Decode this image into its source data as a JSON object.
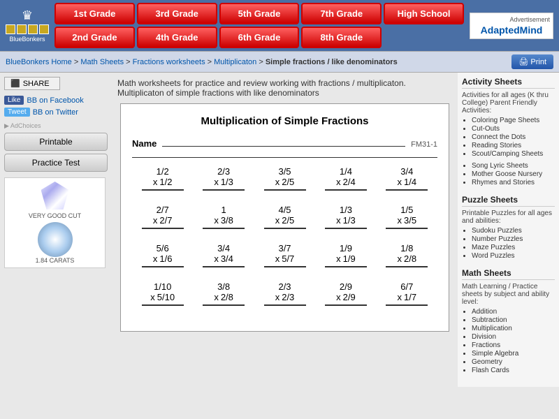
{
  "header": {
    "logo_name": "BlueBonkers",
    "grade_buttons": [
      "1st Grade",
      "3rd Grade",
      "5th Grade",
      "7th Grade",
      "High School",
      "2nd Grade",
      "4th Grade",
      "6th Grade",
      "8th Grade"
    ],
    "adapted_mind_label": "AdaptedMind"
  },
  "breadcrumb": {
    "items": [
      "BlueBonkers Home",
      "Math Sheets",
      "Fractions worksheets",
      "Multiplicaton"
    ],
    "current": "Simple fractions / like denominators"
  },
  "print_btn": "🖨 Print",
  "left_sidebar": {
    "share_label": "SHARE",
    "fb_label": "Like",
    "fb_link": "BB on Facebook",
    "tw_label": "Tweet",
    "tw_link": "BB on Twitter",
    "adchoices": "▶ AdChoices",
    "printable_label": "Printable",
    "practice_label": "Practice Test",
    "ad_text": "VERY GOOD CUT",
    "ad_carats": "1.84 CARATS"
  },
  "intro": {
    "line1": "Math worksheets for practice and review working with fractions / multiplicaton.",
    "line2": "Multiplicaton of simple fractions with like denominators"
  },
  "worksheet": {
    "title": "Multiplication of Simple Fractions",
    "name_label": "Name",
    "ws_id": "FM31-1",
    "problems": [
      [
        {
          "top": "1/2",
          "x": "x",
          "bot": "1/2"
        },
        {
          "top": "2/3",
          "x": "x",
          "bot": "1/3"
        },
        {
          "top": "3/5",
          "x": "x",
          "bot": "2/5"
        },
        {
          "top": "1/4",
          "x": "x",
          "bot": "2/4"
        },
        {
          "top": "3/4",
          "x": "x",
          "bot": "1/4"
        }
      ],
      [
        {
          "top": "2/7",
          "x": "x",
          "bot": "2/7"
        },
        {
          "top": "1",
          "x": "x",
          "bot": "3/8"
        },
        {
          "top": "4/5",
          "x": "x",
          "bot": "2/5"
        },
        {
          "top": "1/3",
          "x": "x",
          "bot": "1/3"
        },
        {
          "top": "1/5",
          "x": "x",
          "bot": "3/5"
        }
      ],
      [
        {
          "top": "5/6",
          "x": "x",
          "bot": "1/6"
        },
        {
          "top": "3/4",
          "x": "x",
          "bot": "3/4"
        },
        {
          "top": "3/7",
          "x": "x",
          "bot": "5/7"
        },
        {
          "top": "1/9",
          "x": "x",
          "bot": "1/9"
        },
        {
          "top": "1/8",
          "x": "x",
          "bot": "2/8"
        }
      ],
      [
        {
          "top": "1/10",
          "x": "x",
          "bot": "5/10"
        },
        {
          "top": "3/8",
          "x": "x",
          "bot": "2/8"
        },
        {
          "top": "2/3",
          "x": "x",
          "bot": "2/3"
        },
        {
          "top": "2/9",
          "x": "x",
          "bot": "2/9"
        },
        {
          "top": "6/7",
          "x": "x",
          "bot": "1/7"
        }
      ]
    ]
  },
  "right_sidebar": {
    "activity_title": "Activity Sheets",
    "activity_desc": "Activities for all ages (K thru College) Parent Friendly Activities:",
    "activity_items": [
      "Coloring Page Sheets",
      "Cut-Outs",
      "Connect the Dots",
      "Reading Stories",
      "Scout/Camping Sheets"
    ],
    "activity_extra": [
      "Song Lyric Sheets",
      "Mother Goose Nursery",
      "Rhymes and Stories"
    ],
    "puzzle_title": "Puzzle Sheets",
    "puzzle_desc": "Printable Puzzles for all ages and abilities:",
    "puzzle_items": [
      "Sudoku Puzzles",
      "Number Puzzles",
      "Maze Puzzles",
      "Word Puzzles"
    ],
    "math_title": "Math Sheets",
    "math_desc": "Math Learning / Practice sheets by subject and ability level:",
    "math_items": [
      "Addition",
      "Subtraction",
      "Multiplication",
      "Division",
      "Fractions",
      "Simple Algebra",
      "Geometry",
      "Flash Cards"
    ]
  }
}
